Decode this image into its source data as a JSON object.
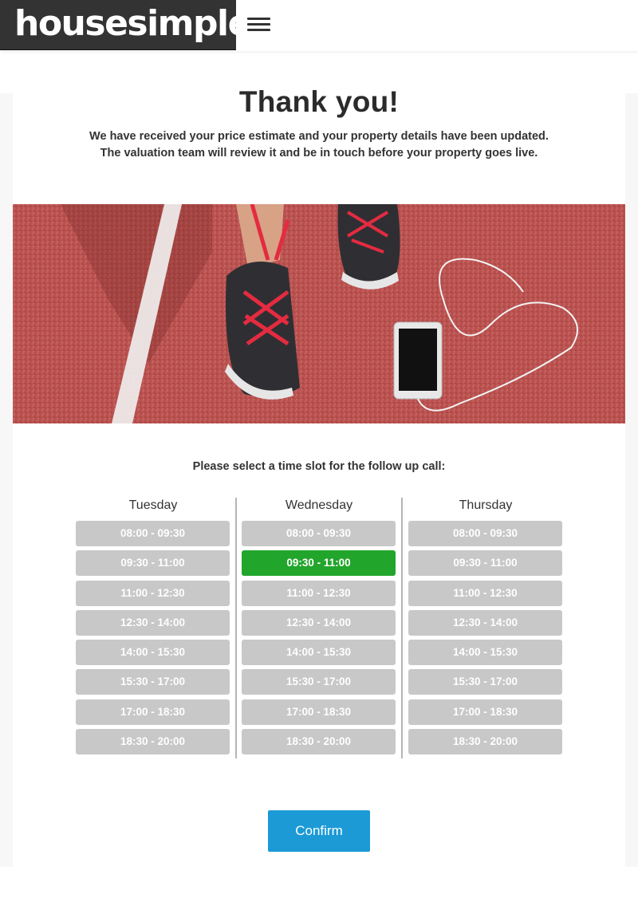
{
  "header": {
    "logo_text": "housesimple",
    "menu_icon": "hamburger-menu-icon"
  },
  "main": {
    "title": "Thank you!",
    "message_line1": "We have received your price estimate and your property details have been updated.",
    "message_line2": "The valuation team will review it and be in touch before your property goes live.",
    "slot_prompt": "Please select a time slot for the follow up call:"
  },
  "schedule": {
    "days": [
      {
        "name": "Tuesday",
        "slots": [
          "08:00 - 09:30",
          "09:30 - 11:00",
          "11:00 - 12:30",
          "12:30 - 14:00",
          "14:00 - 15:30",
          "15:30 - 17:00",
          "17:00 - 18:30",
          "18:30 - 20:00"
        ]
      },
      {
        "name": "Wednesday",
        "slots": [
          "08:00 - 09:30",
          "09:30 - 11:00",
          "11:00 - 12:30",
          "12:30 - 14:00",
          "14:00 - 15:30",
          "15:30 - 17:00",
          "17:00 - 18:30",
          "18:30 - 20:00"
        ]
      },
      {
        "name": "Thursday",
        "slots": [
          "08:00 - 09:30",
          "09:30 - 11:00",
          "11:00 - 12:30",
          "12:30 - 14:00",
          "14:00 - 15:30",
          "15:30 - 17:00",
          "17:00 - 18:30",
          "18:30 - 20:00"
        ]
      }
    ],
    "selected": {
      "day": "Wednesday",
      "slot": "09:30 - 11:00"
    }
  },
  "confirm_label": "Confirm",
  "colors": {
    "accent": "#1c9ad6",
    "selected_slot": "#22a52b",
    "slot": "#c8c8c8",
    "logo_bg": "#333333"
  }
}
